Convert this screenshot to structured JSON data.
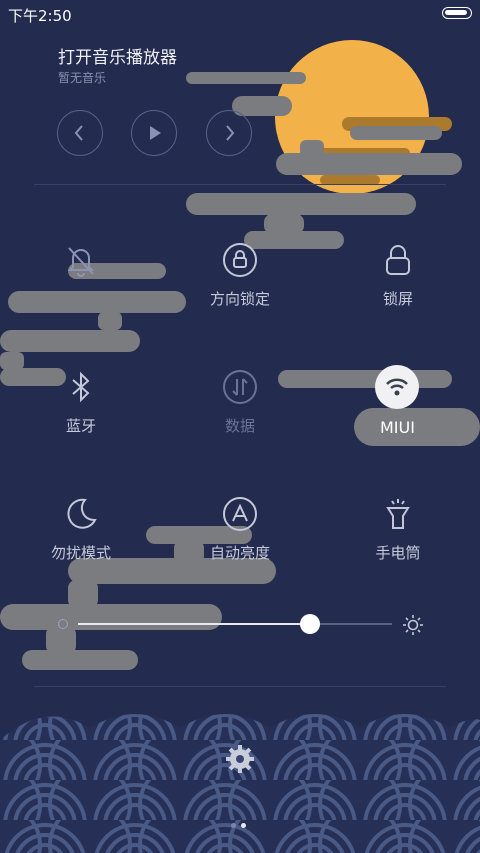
{
  "status": {
    "time": "下午2:50"
  },
  "music": {
    "title": "打开音乐播放器",
    "subtitle": "暂无音乐",
    "controls": [
      {
        "name": "previous-button",
        "icon": "chevron-left-icon"
      },
      {
        "name": "play-button",
        "icon": "play-icon"
      },
      {
        "name": "next-button",
        "icon": "chevron-right-icon"
      }
    ]
  },
  "toggles": {
    "mute": {
      "label": "",
      "icon": "bell-off-icon",
      "active": false
    },
    "rotation_lock": {
      "label": "方向锁定",
      "icon": "rotation-lock-icon",
      "active": false
    },
    "lock_screen": {
      "label": "锁屏",
      "icon": "lock-icon",
      "active": false
    },
    "bluetooth": {
      "label": "蓝牙",
      "icon": "bluetooth-icon",
      "active": false
    },
    "data": {
      "label": "数据",
      "icon": "data-transfer-icon",
      "active": false
    },
    "wifi": {
      "label": "MIUI",
      "icon": "wifi-icon",
      "active": true
    },
    "dnd": {
      "label": "勿扰模式",
      "icon": "moon-icon",
      "active": false
    },
    "auto_brightness": {
      "label": "自动亮度",
      "icon": "auto-brightness-icon",
      "active": false
    },
    "flashlight": {
      "label": "手电筒",
      "icon": "flashlight-icon",
      "active": false
    }
  },
  "brightness": {
    "level_fraction": 0.74
  },
  "pager": {
    "pages": 2,
    "current": 2
  },
  "colors": {
    "background": "#232b4e",
    "moon": "#f3b14a",
    "cloud": "#7b7c80",
    "sea": "#4a5a86"
  }
}
